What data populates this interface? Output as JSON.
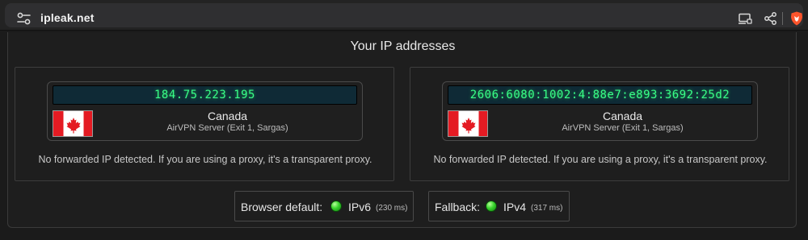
{
  "browser": {
    "url": "ipleak.net"
  },
  "page": {
    "title": "Your IP addresses",
    "addresses": [
      {
        "ip": "184.75.223.195",
        "country": "Canada",
        "server": "AirVPN Server (Exit 1, Sargas)",
        "note": "No forwarded IP detected. If you are using a proxy, it's a transparent proxy."
      },
      {
        "ip": "2606:6080:1002:4:88e7:e893:3692:25d2",
        "country": "Canada",
        "server": "AirVPN Server (Exit 1, Sargas)",
        "note": "No forwarded IP detected. If you are using a proxy, it's a transparent proxy."
      }
    ],
    "browser_default": {
      "label": "Browser default:",
      "protocol": "IPv6",
      "time": "(230 ms)"
    },
    "fallback": {
      "label": "Fallback:",
      "protocol": "IPv4",
      "time": "(317 ms)"
    }
  },
  "colors": {
    "ip_text": "#39ff88",
    "ip_background": "#0f2a36",
    "status_ok": "#38d42c",
    "brave_accent": "#fb542b"
  },
  "icons": {
    "site_settings": "site-settings-icon",
    "cast": "cast-to-device-icon",
    "share": "share-icon",
    "brave": "brave-shields-icon",
    "flag": "canada-flag-icon"
  }
}
